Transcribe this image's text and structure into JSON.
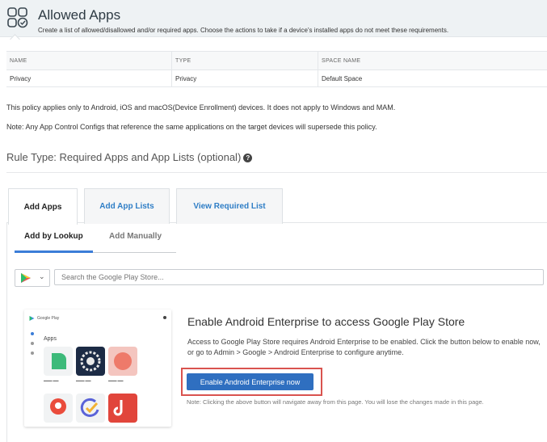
{
  "header": {
    "title": "Allowed Apps",
    "subtitle": "Create a list of allowed/disallowed and/or required apps. Choose the actions to take if a device's installed apps do not meet these requirements."
  },
  "table": {
    "columns": [
      "NAME",
      "TYPE",
      "SPACE NAME"
    ],
    "rows": [
      {
        "name": "Privacy",
        "type": "Privacy",
        "space": "Default Space"
      }
    ]
  },
  "notes": {
    "line1": "This policy applies only to Android, iOS and macOS(Device Enrollment) devices. It does not apply to Windows and MAM.",
    "line2": "Note: Any App Control Configs that reference the same applications on the target devices will supersede this policy."
  },
  "rule": {
    "label": "Rule Type: Required Apps and App Lists (optional)",
    "help_icon": "help-circle-icon"
  },
  "tabs": [
    {
      "label": "Add Apps",
      "active": true
    },
    {
      "label": "Add App Lists",
      "active": false
    },
    {
      "label": "View Required List",
      "active": false
    }
  ],
  "subtabs": [
    {
      "label": "Add by Lookup",
      "active": true
    },
    {
      "label": "Add Manually",
      "active": false
    }
  ],
  "search": {
    "store_icon": "google-play-icon",
    "placeholder": "Search the Google Play Store..."
  },
  "preview": {
    "store_label": "Google Play",
    "apps_label": "Apps"
  },
  "enterprise": {
    "title": "Enable Android Enterprise to access Google Play Store",
    "description": "Access to Google Play Store requires Android Enterprise to be enabled. Click the button below to enable now, or go to Admin > Google > Android Enterprise to configure anytime.",
    "button_label": "Enable Android Enterprise now",
    "note": "Note: Clicking the above button will navigate away from this page. You will lose the changes made in this page."
  },
  "colors": {
    "header_bg": "#eef2f4",
    "accent": "#2f7ec6",
    "button": "#2f6fc0",
    "highlight": "#d9534f"
  }
}
